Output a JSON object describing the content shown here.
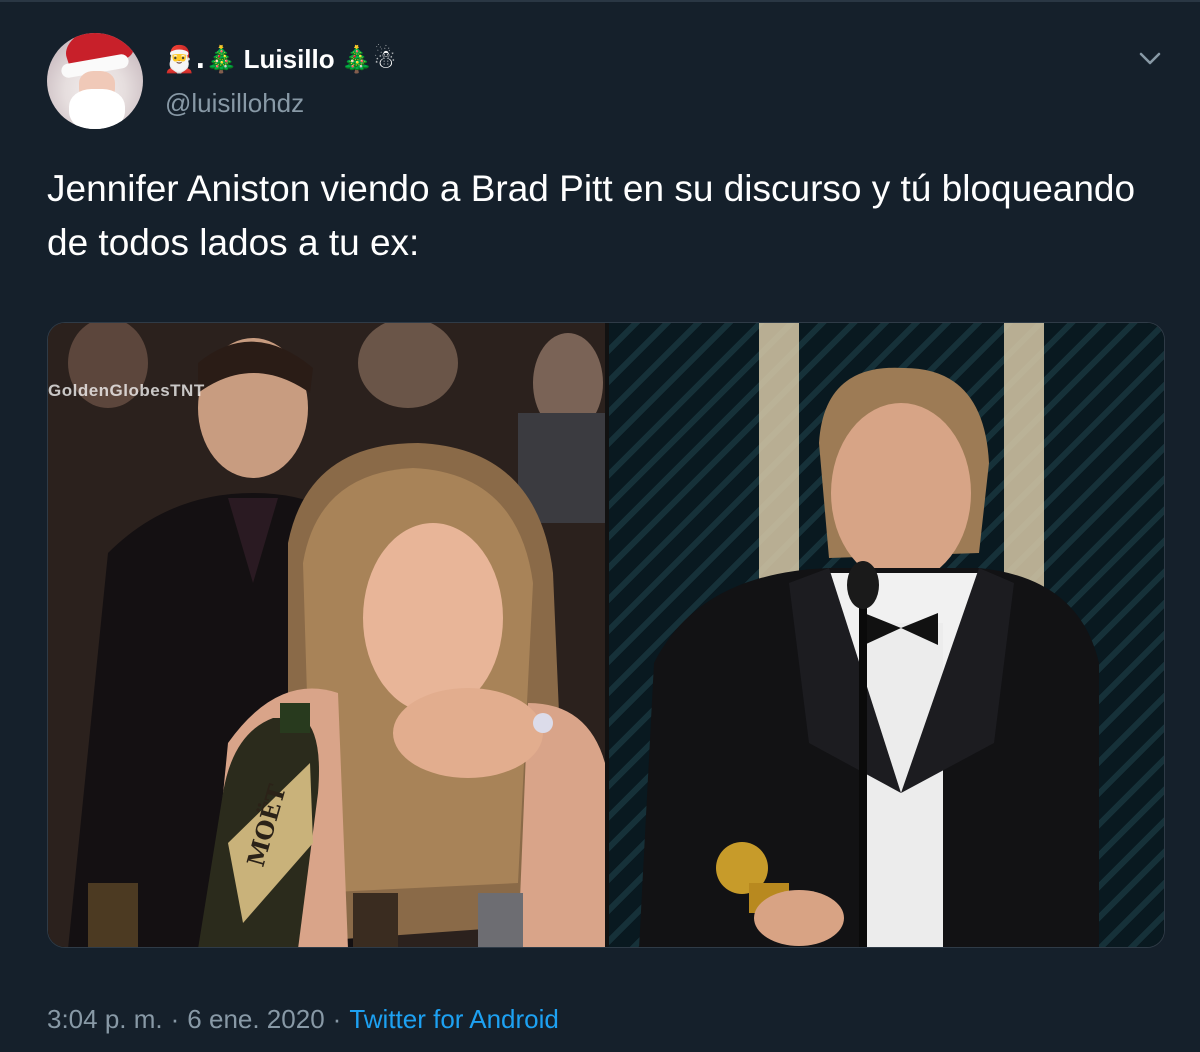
{
  "author": {
    "display_name": "Luisillo",
    "name_prefix_emoji": "🎅.🎄",
    "name_suffix_emoji": "🎄☃",
    "handle": "@luisillohdz",
    "avatar_icon": "santa-avatar"
  },
  "tweet": {
    "text": "Jennifer Aniston viendo a Brad Pitt en su discurso y tú bloqueando de todos lados a tu ex:",
    "media": {
      "left_watermark": "GoldenGlobesTNT",
      "left_bottle_label": "MOËT"
    }
  },
  "meta": {
    "time": "3:04 p. m.",
    "separator": "·",
    "date": "6 ene. 2020",
    "source": "Twitter for Android"
  },
  "colors": {
    "background": "#15202b",
    "secondary_text": "#8899a6",
    "link": "#1da1f2"
  }
}
